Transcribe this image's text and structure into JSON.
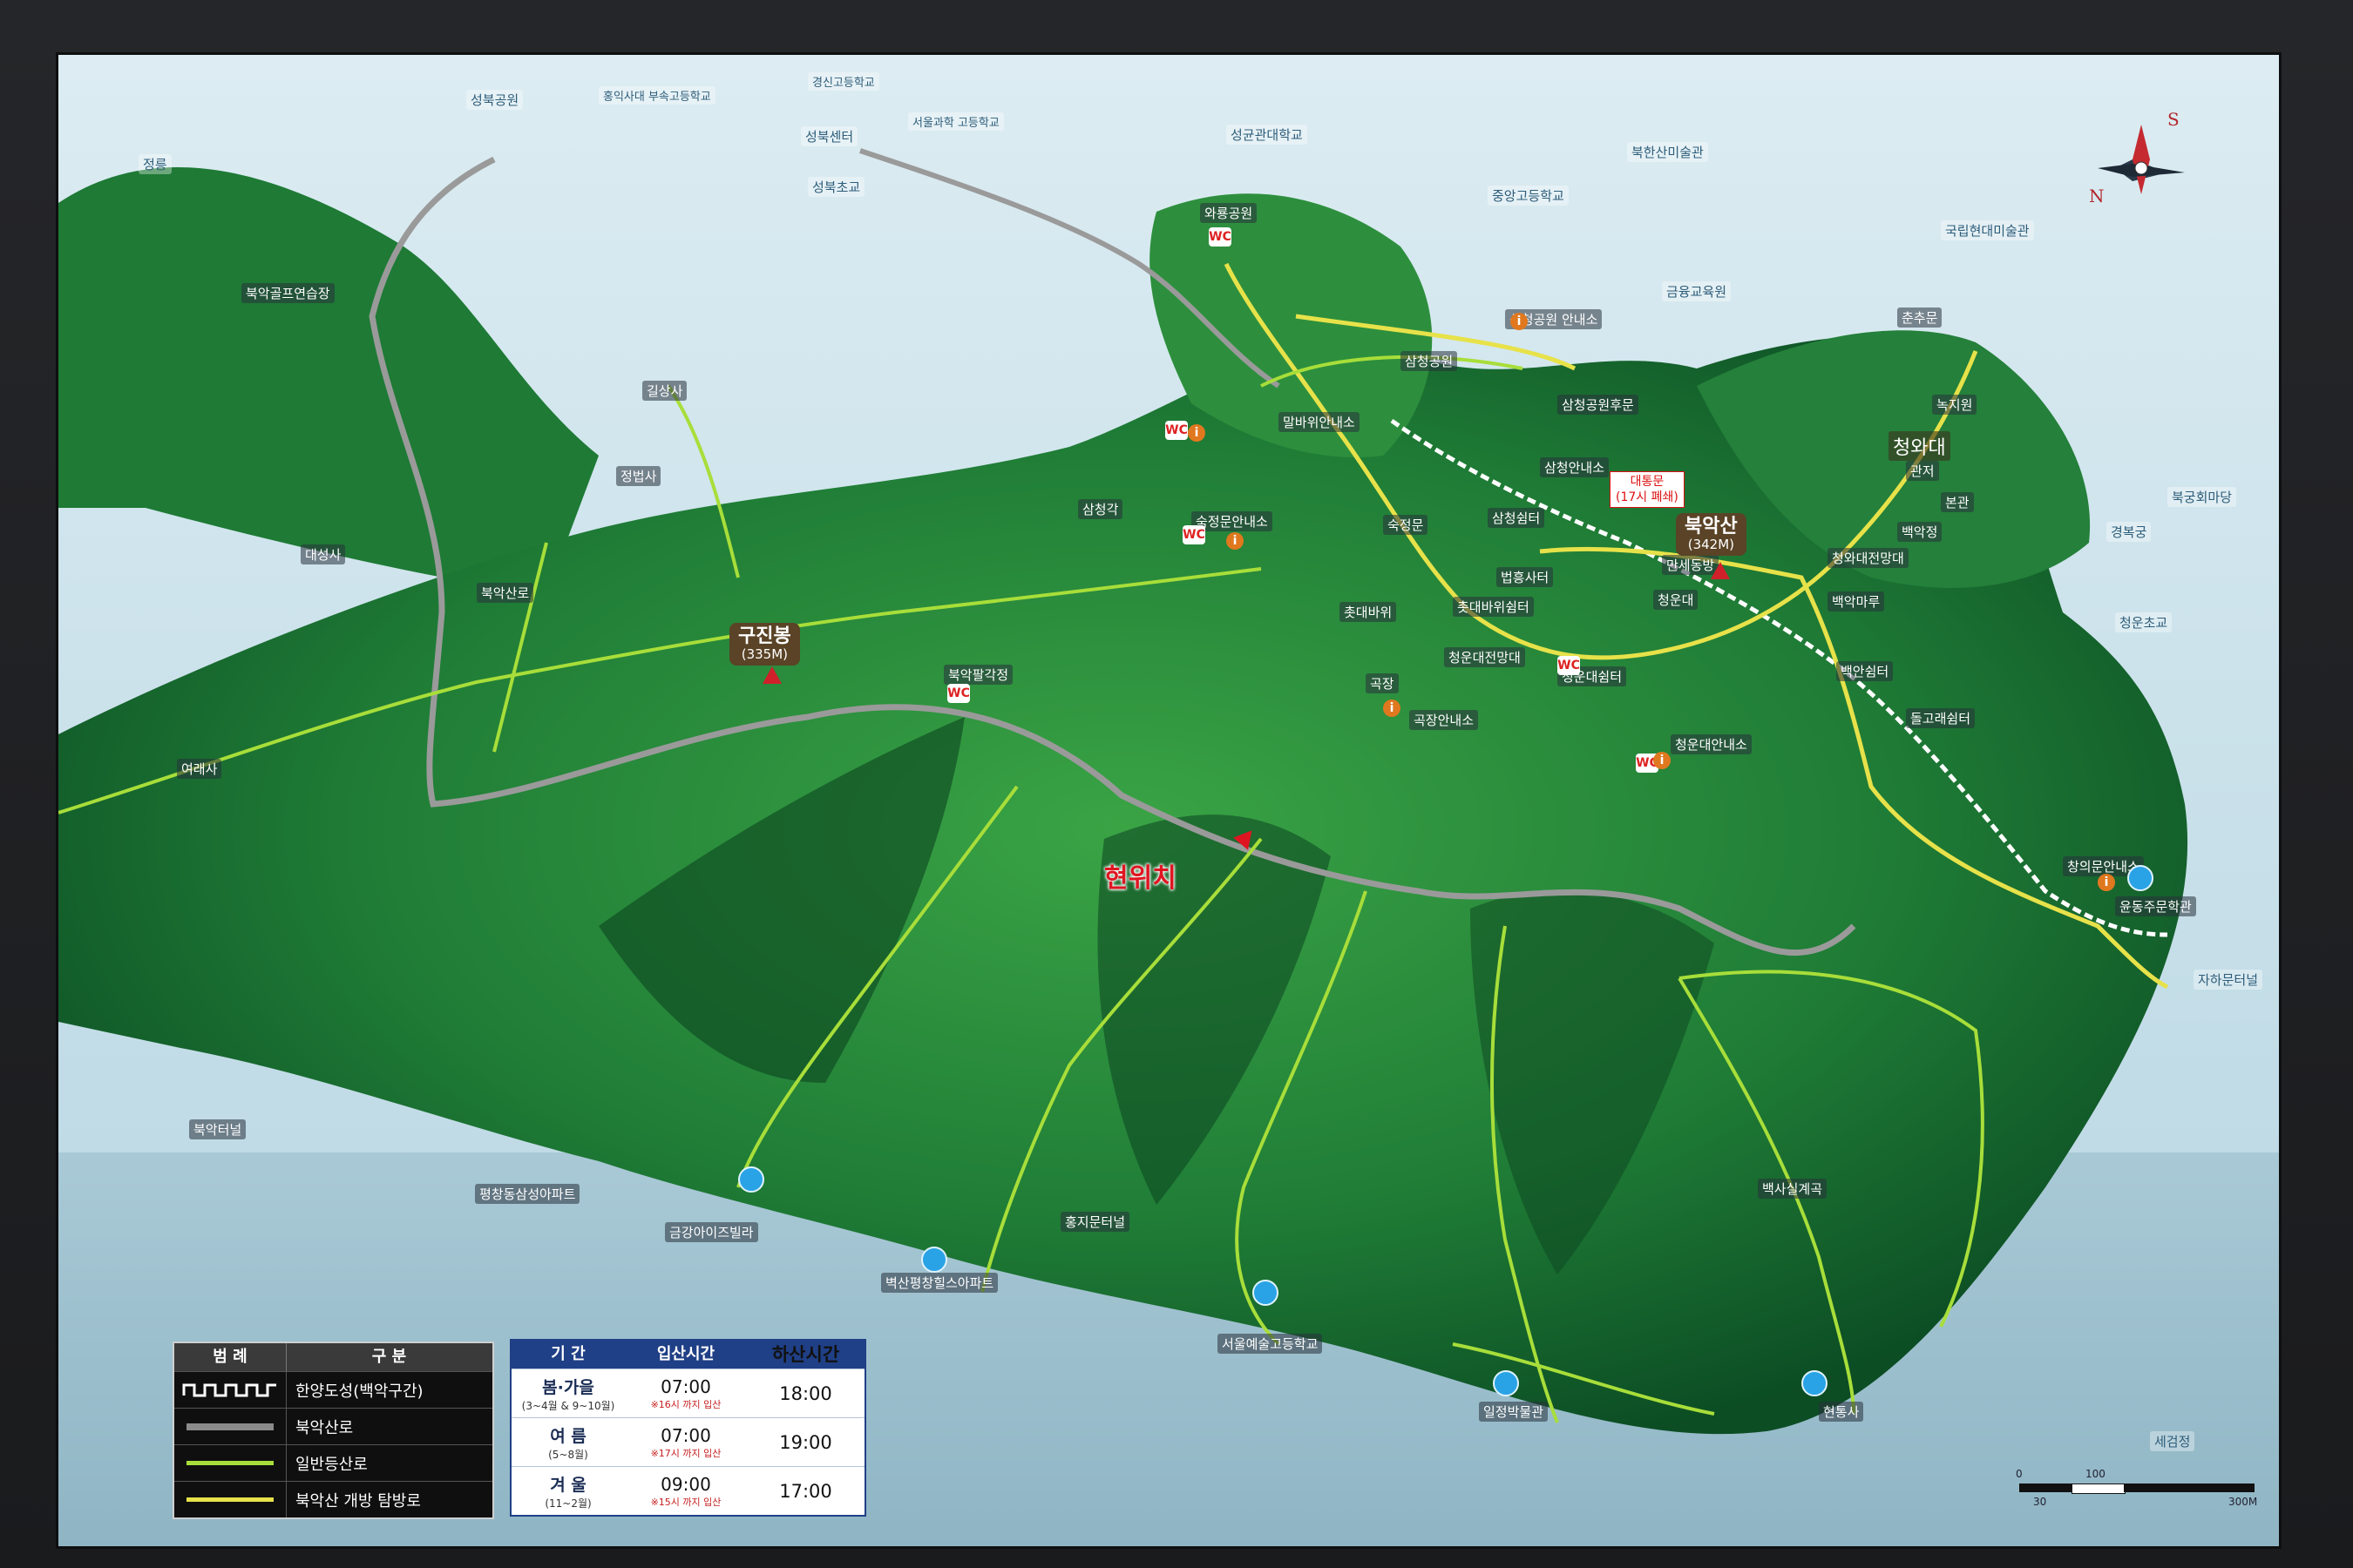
{
  "labels": {
    "seongbuk_park": "성북공원",
    "jeongneung": "정릉",
    "hongik_school": "홍익사대 부속고등학교",
    "gyeongsin": "경신고등학교",
    "seoul_sci": "서울과학 고등학교",
    "seongbuk_center": "성북센터",
    "seongbuk_cho": "성북초교",
    "waryong_park": "와룡공원",
    "sungkyun": "성균관대학교",
    "bukhan_museum": "북한산미술관",
    "jungang_hs": "중앙고등학교",
    "gukrip_museum": "국립현대미술관",
    "bukak_golf": "북악골프연습장",
    "gilsangsa": "길상사",
    "jeongbeopsa": "정법사",
    "daeseongsa": "대성사",
    "bukaksanro": "북악산로",
    "samcheong_park": "삼청공원",
    "samcheong_info": "삼청공원 안내소",
    "malbawi": "말바위안내소",
    "samcheonggak": "삼청각",
    "sukjeongmun_info": "숙정문안내소",
    "sukjeongmun": "숙정문",
    "samcheong_shelter": "삼청쉼터",
    "samcheong_anne": "삼청안내소",
    "beopheung": "법흥사터",
    "chotdaebawi": "촛대바위",
    "chotdae_shelter": "촛대바위쉼터",
    "cheongun_view": "청운대전망대",
    "cheongun": "청운대",
    "manse": "만세동방",
    "gakjeong": "곡장",
    "gakjeong_info": "곡장안내소",
    "cheongun_shelter": "청운대쉼터",
    "cheongun_info": "청운대안내소",
    "bugakpalgakjeong": "북악팔각정",
    "yeoraesa": "여래사",
    "bukak_tunnel": "북악터널",
    "pyeongchang_apt": "평창동삼성아파트",
    "geumgang_villa": "금강아이즈빌라",
    "byeoksan_apt": "벽산평창힐스아파트",
    "hongji_tunnel": "홍지문터널",
    "seoul_arts_hs": "서울예술고등학교",
    "eonjeong_museum": "일정박물관",
    "baeksasil": "백사실계곡",
    "hyeonseosa": "현통사",
    "baekak_jeong": "백악정",
    "cheongwadae_view": "청와대전망대",
    "baekak_maru": "백악마루",
    "baekan_shelter": "백안쉼터",
    "dolgore_shelter": "돌고래쉼터",
    "changuimun_info": "창의문안내소",
    "yunssongju": "윤동주문학관",
    "chunchugwan": "춘추문",
    "cheongwadae": "청와대",
    "sanghap": "녹지원",
    "gwanjeo": "관저",
    "bongwan": "본관",
    "jahamun": "자하문터널",
    "gyeongbok": "경복궁",
    "jeongdong_school": "청운초교",
    "samcheong_gate": "삼청공원후문",
    "hanok": "금융교육원",
    "sejong": "세검정",
    "gyeongbokgung_west": "북궁회마당"
  },
  "peaks": [
    {
      "name": "구진봉",
      "elev": "(335M)"
    },
    {
      "name": "북악산",
      "elev": "(342M)"
    }
  ],
  "current_location": "현위치",
  "closed_sign": {
    "name": "대통문",
    "note": "(17시 폐쇄)"
  },
  "compass": {
    "n": "N",
    "s": "S"
  },
  "legend": {
    "header": [
      "범 례",
      "구 분"
    ],
    "rows": [
      {
        "label": "한양도성(백악구간)",
        "symbol": "fortress-wall"
      },
      {
        "label": "북악산로",
        "symbol": "road-gray"
      },
      {
        "label": "일반등산로",
        "symbol": "trail-green"
      },
      {
        "label": "북악산 개방 탐방로",
        "symbol": "trail-yellow"
      }
    ]
  },
  "hours": {
    "header": [
      "기 간",
      "입산시간",
      "하산시간"
    ],
    "rows": [
      {
        "season": "봄·가을",
        "months": "(3~4월 & 9~10월)",
        "entry": "07:00",
        "note": "※16시 까지 입산",
        "exit": "18:00"
      },
      {
        "season": "여 름",
        "months": "(5~8월)",
        "entry": "07:00",
        "note": "※17시 까지 입산",
        "exit": "19:00"
      },
      {
        "season": "겨 울",
        "months": "(11~2월)",
        "entry": "09:00",
        "note": "※15시 까지 입산",
        "exit": "17:00"
      }
    ]
  },
  "scale": {
    "t0": "0",
    "t100": "100",
    "t30": "30",
    "t300": "300M"
  },
  "colors": {
    "trail_green": "#a8de3a",
    "trail_yellow": "#e7e24a",
    "wall": "#ffffff",
    "road": "#9a9a9a",
    "forest_dark": "#0f5b2c",
    "forest_light": "#3aa445",
    "urban": "#b9d8e6",
    "accent_red": "#d0202a",
    "gate_blue": "#2aa3e6"
  }
}
